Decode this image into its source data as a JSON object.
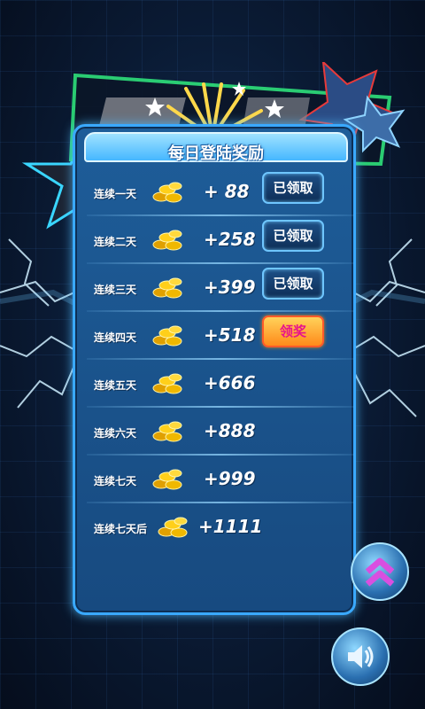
{
  "header": {
    "title": "每日登陆奖励"
  },
  "rewards": [
    {
      "day": "连续一天",
      "amount": "+ 88",
      "status": "claimed"
    },
    {
      "day": "连续二天",
      "amount": "+258",
      "status": "claimed"
    },
    {
      "day": "连续三天",
      "amount": "+399",
      "status": "claimed"
    },
    {
      "day": "连续四天",
      "amount": "+518",
      "status": "claim"
    },
    {
      "day": "连续五天",
      "amount": "+666",
      "status": "none"
    },
    {
      "day": "连续六天",
      "amount": "+888",
      "status": "none"
    },
    {
      "day": "连续七天",
      "amount": "+999",
      "status": "none"
    },
    {
      "day": "连续七天后",
      "amount": "+1111",
      "status": "none"
    }
  ],
  "buttons": {
    "claimed_label": "已领取",
    "claim_label": "领奖"
  },
  "colors": {
    "panel": "#1e5d99",
    "border": "#3aa9ff",
    "claim_text": "#e8138c",
    "claim_bg": "#ffb03a"
  },
  "icons": {
    "coin": "gold-coin-stack-icon",
    "upgrade": "double-chevron-up-icon",
    "sound": "speaker-icon"
  }
}
